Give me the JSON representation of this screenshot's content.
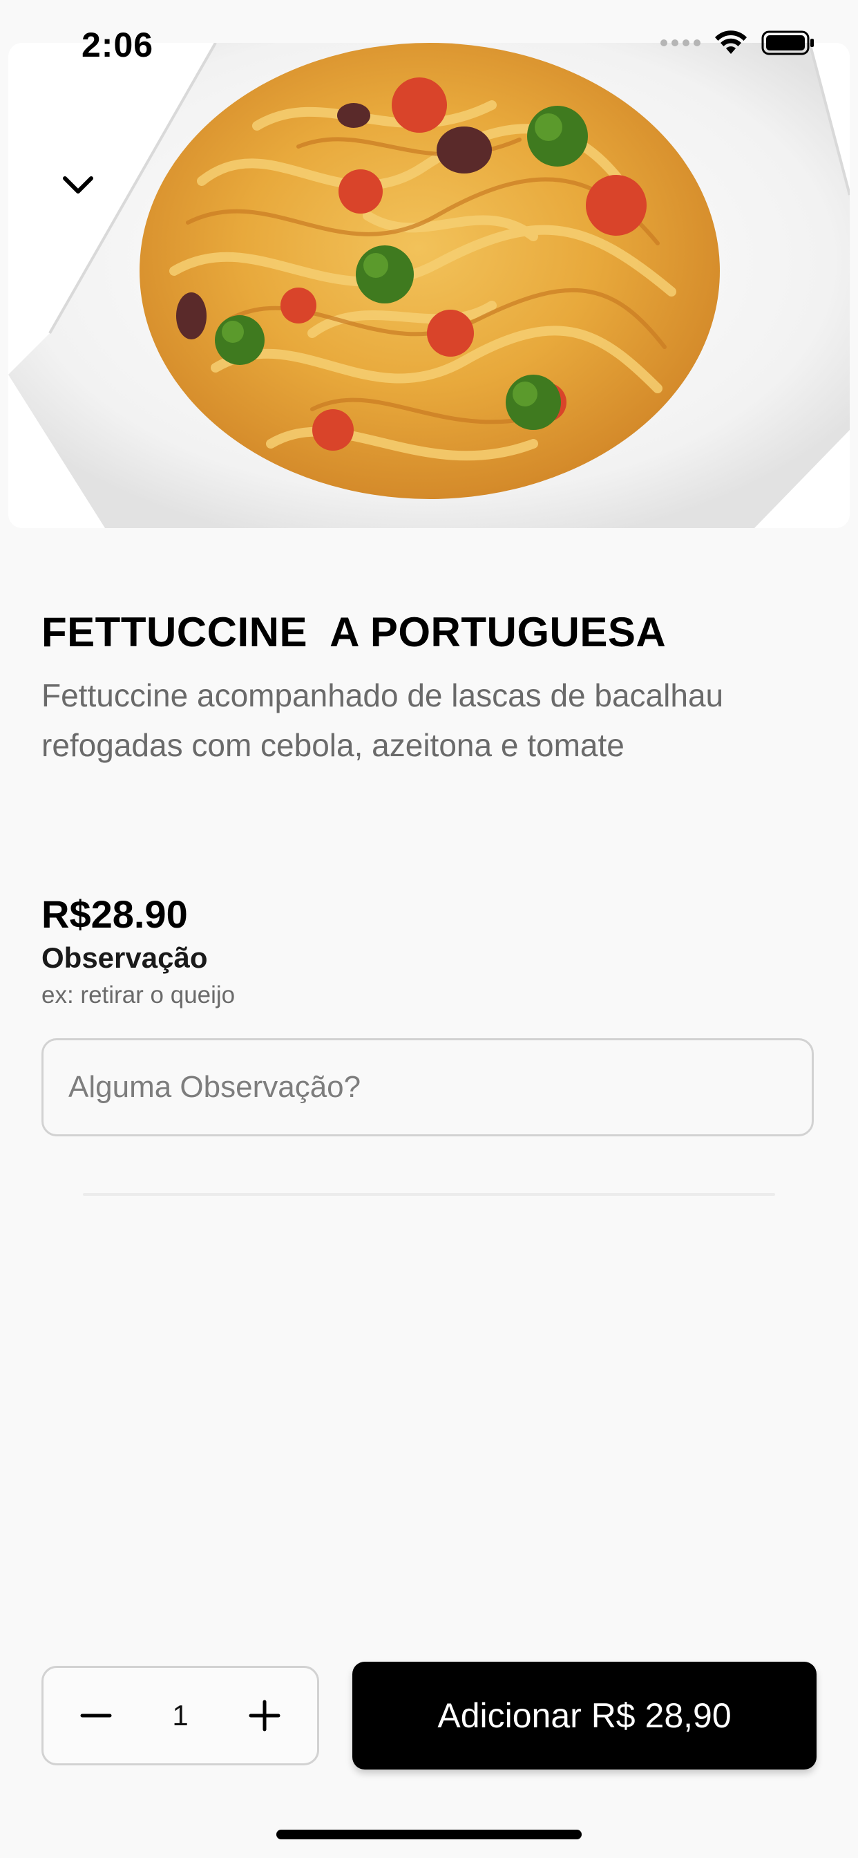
{
  "status_bar": {
    "time": "2:06",
    "icons": [
      "signal-icon",
      "wifi-icon",
      "battery-icon"
    ]
  },
  "hero": {
    "image": "pasta-dish-photo",
    "back_icon": "chevron-down-icon"
  },
  "product": {
    "title": "FETTUCCINE  A PORTUGUESA",
    "description": "Fettuccine acompanhado de lascas de bacalhau refogadas com cebola, azeitona e tomate",
    "price": "R$28.90"
  },
  "observation": {
    "label": "Observação",
    "hint": "ex: retirar o queijo",
    "placeholder": "Alguma Observação?",
    "value": ""
  },
  "footer": {
    "quantity": "1",
    "minus_icon": "minus-icon",
    "plus_icon": "plus-icon",
    "add_label": "Adicionar R$ 28,90"
  },
  "colors": {
    "background": "#f9f9f9",
    "primary_button": "#000000",
    "text_primary": "#000000",
    "text_secondary": "#6a6a6a",
    "border": "#d2d2d2"
  }
}
